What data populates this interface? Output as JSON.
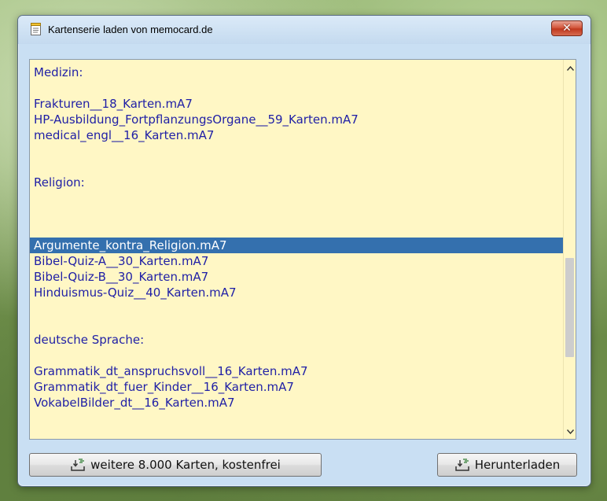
{
  "window": {
    "title": "Kartenserie laden von memocard.de",
    "close_label": "✕"
  },
  "list": {
    "selected_index": 11,
    "items": [
      "Medizin:",
      "",
      "Frakturen__18_Karten.mA7",
      "HP-Ausbildung_FortpflanzungsOrgane__59_Karten.mA7",
      "medical_engl__16_Karten.mA7",
      "",
      "",
      "Religion:",
      "",
      "",
      "",
      "Argumente_kontra_Religion.mA7",
      "Bibel-Quiz-A__30_Karten.mA7",
      "Bibel-Quiz-B__30_Karten.mA7",
      "Hinduismus-Quiz__40_Karten.mA7",
      "",
      "",
      "deutsche Sprache:",
      "",
      "Grammatik_dt_anspruchsvoll__16_Karten.mA7",
      "Grammatik_dt_fuer_Kinder__16_Karten.mA7",
      "VokabelBilder_dt__16_Karten.mA7"
    ]
  },
  "buttons": {
    "more_cards": "weitere 8.000 Karten, kostenfrei",
    "download": "Herunterladen"
  },
  "colors": {
    "list_background": "#fff7c5",
    "list_text": "#1f1fa6",
    "selection": "#3470ae"
  },
  "icons": {
    "app": "notepad-icon",
    "button": "download-tray-icon"
  }
}
